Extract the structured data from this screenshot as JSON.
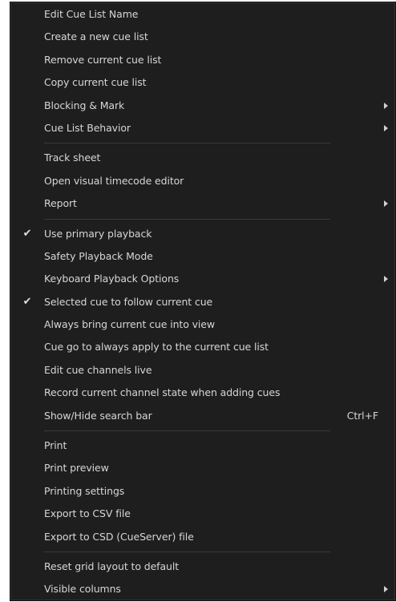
{
  "menu": {
    "group1": [
      {
        "label": "Edit Cue List Name"
      },
      {
        "label": "Create a new cue list"
      },
      {
        "label": "Remove current cue list"
      },
      {
        "label": "Copy current cue list"
      },
      {
        "label": "Blocking & Mark",
        "submenu": true
      },
      {
        "label": "Cue List Behavior",
        "submenu": true
      }
    ],
    "group2": [
      {
        "label": "Track sheet"
      },
      {
        "label": "Open visual timecode editor"
      },
      {
        "label": "Report",
        "submenu": true
      }
    ],
    "group3": [
      {
        "label": "Use primary playback",
        "checked": true,
        "check_glyph": "✔"
      },
      {
        "label": "Safety Playback Mode"
      },
      {
        "label": "Keyboard Playback Options",
        "submenu": true
      },
      {
        "label": "Selected cue to follow current cue",
        "checked": true,
        "check_glyph": "✔"
      },
      {
        "label": "Always bring current cue into view"
      },
      {
        "label": "Cue go to always apply to the current cue list"
      },
      {
        "label": "Edit cue channels live"
      },
      {
        "label": "Record current channel state when adding cues"
      },
      {
        "label": "Show/Hide search bar",
        "shortcut": "Ctrl+F"
      }
    ],
    "group4": [
      {
        "label": "Print"
      },
      {
        "label": "Print preview"
      },
      {
        "label": "Printing settings"
      },
      {
        "label": "Export to CSV file"
      },
      {
        "label": "Export to CSD (CueServer) file"
      }
    ],
    "group5": [
      {
        "label": "Reset grid layout to default"
      },
      {
        "label": "Visible columns",
        "submenu": true
      }
    ]
  },
  "icons": {
    "check": "checkmark-icon",
    "submenu": "submenu-arrow-icon"
  },
  "colors": {
    "menu_background": "#1e1e1e",
    "text": "#d6d6d6",
    "separator": "#3a3a3a"
  }
}
